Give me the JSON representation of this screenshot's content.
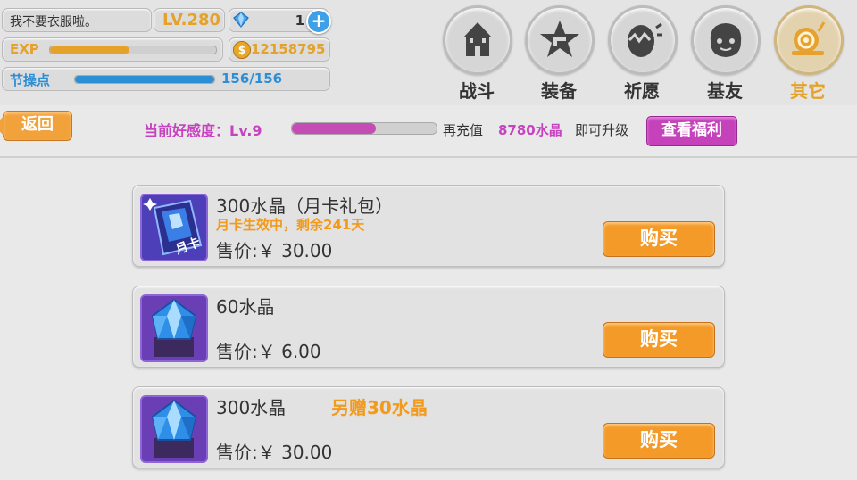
{
  "player": {
    "name": "我不要衣服啦。",
    "level": "LV.280",
    "gems": "1",
    "exp_label": "EXP",
    "exp_progress": 0.48,
    "coins": "12158795",
    "stamina_label": "节操点",
    "stamina": "156/156",
    "stamina_progress": 1.0
  },
  "nav": {
    "items": [
      {
        "label": "战斗",
        "icon": "castle-icon",
        "active": false
      },
      {
        "label": "装备",
        "icon": "star-gun-icon",
        "active": false
      },
      {
        "label": "祈愿",
        "icon": "egg-icon",
        "active": false
      },
      {
        "label": "基友",
        "icon": "friend-face-icon",
        "active": false
      },
      {
        "label": "其它",
        "icon": "snail-icon",
        "active": true
      }
    ]
  },
  "favor": {
    "back_label": "返回",
    "label": "当前好感度：Lv.9",
    "progress": 0.58,
    "recharge_prefix": "再充值",
    "recharge_amount": "8780水晶",
    "recharge_suffix": "即可升级",
    "benefit_button": "查看福利"
  },
  "shop": {
    "items": [
      {
        "title": "300水晶（月卡礼包）",
        "bonus": "",
        "subtitle": "月卡生效中，剩余241天",
        "price": "售价:￥ 30.00",
        "buy_label": "购买",
        "icon": "monthly-card-icon",
        "card_text": "月卡"
      },
      {
        "title": "60水晶",
        "bonus": "",
        "subtitle": "",
        "price": "售价:￥ 6.00",
        "buy_label": "购买",
        "icon": "crystal-icon"
      },
      {
        "title": "300水晶",
        "bonus": "另赠30水晶",
        "subtitle": "",
        "price": "售价:￥ 30.00",
        "buy_label": "购买",
        "icon": "crystal-icon"
      }
    ]
  },
  "colors": {
    "gold": "#e5a22a",
    "blue": "#2c8fd6",
    "magenta": "#c643c0",
    "orange_button": "#f39a28"
  }
}
